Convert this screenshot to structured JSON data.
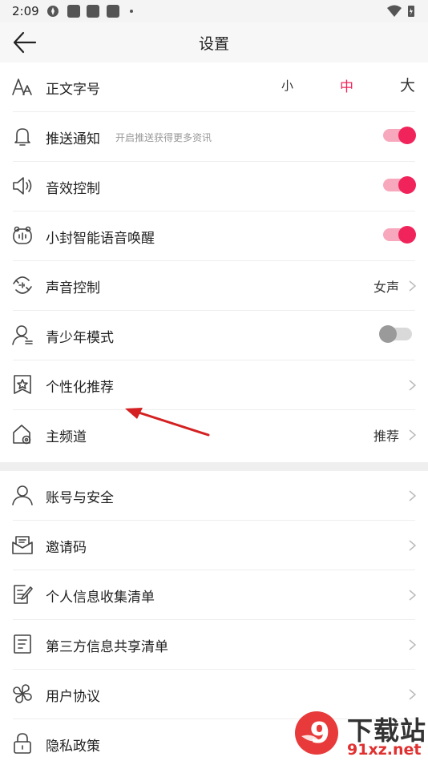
{
  "status_bar": {
    "time": "2:09"
  },
  "header": {
    "title": "设置"
  },
  "font_size": {
    "label": "正文字号",
    "options": [
      "小",
      "中",
      "大"
    ],
    "selected": "中"
  },
  "rows": {
    "push": {
      "label": "推送通知",
      "sub": "开启推送获得更多资讯",
      "on": true
    },
    "sound_effects": {
      "label": "音效控制",
      "on": true
    },
    "voice_wake": {
      "label": "小封智能语音唤醒",
      "on": true
    },
    "voice_control": {
      "label": "声音控制",
      "value": "女声"
    },
    "youth_mode": {
      "label": "青少年模式",
      "on": false
    },
    "personalized": {
      "label": "个性化推荐"
    },
    "main_channel": {
      "label": "主频道",
      "value": "推荐"
    },
    "account": {
      "label": "账号与安全"
    },
    "invite": {
      "label": "邀请码"
    },
    "personal_info": {
      "label": "个人信息收集清单"
    },
    "third_party": {
      "label": "第三方信息共享清单"
    },
    "agreement": {
      "label": "用户协议"
    },
    "privacy": {
      "label": "隐私政策"
    }
  },
  "colors": {
    "accent": "#f0245a",
    "toggle_track_on": "#f7a8bd",
    "annotation_arrow": "#d42020"
  },
  "watermark": {
    "brand": "下载站",
    "domain": "91xz.net",
    "logo_text": "9"
  }
}
